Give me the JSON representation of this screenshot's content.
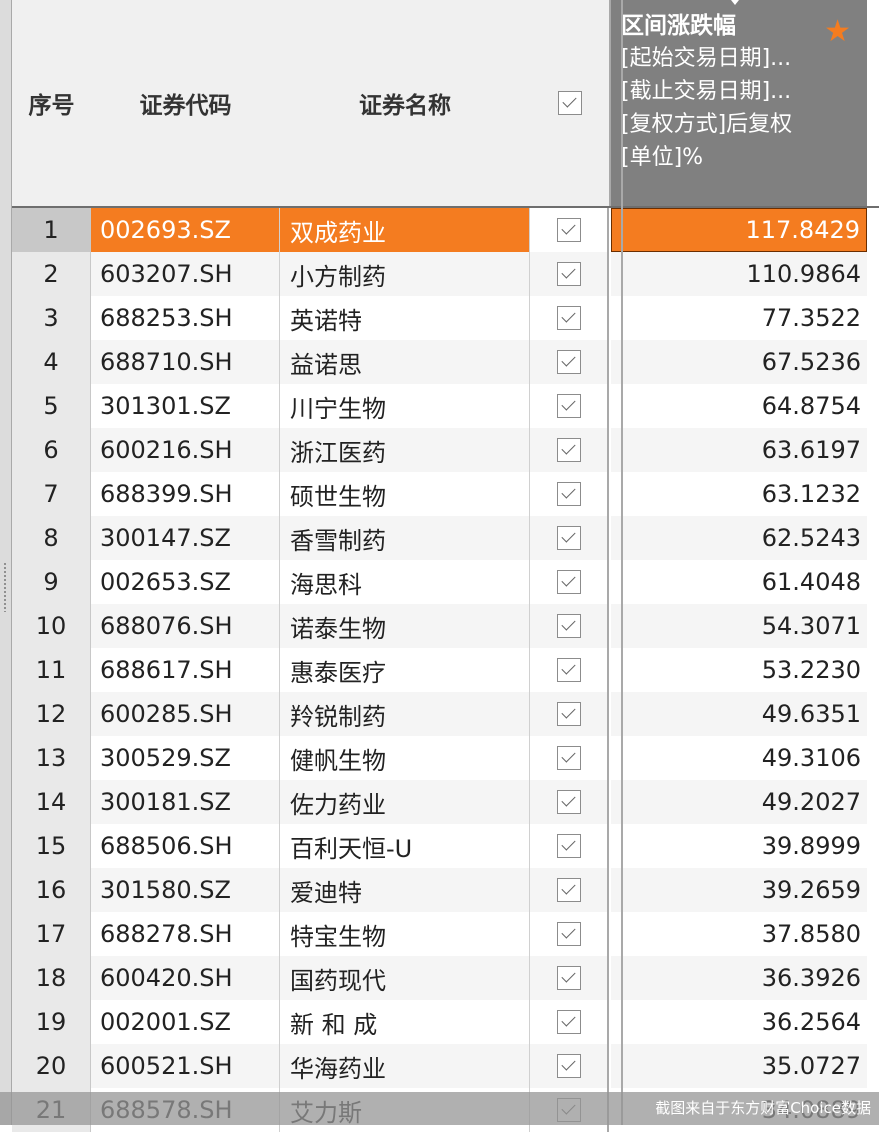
{
  "header": {
    "col_no": "序号",
    "col_code": "证券代码",
    "col_name": "证券名称",
    "col_change": {
      "title": "区间涨跌幅",
      "lines": [
        "[起始交易日期]...",
        "[截止交易日期]...",
        "[复权方式]后复权",
        "[单位]%"
      ],
      "star_icon": "star-icon"
    }
  },
  "rows": [
    {
      "no": "1",
      "code": "002693.SZ",
      "name": "双成药业",
      "value": "117.8429",
      "checked": true
    },
    {
      "no": "2",
      "code": "603207.SH",
      "name": "小方制药",
      "value": "110.9864",
      "checked": true
    },
    {
      "no": "3",
      "code": "688253.SH",
      "name": "英诺特",
      "value": "77.3522",
      "checked": true
    },
    {
      "no": "4",
      "code": "688710.SH",
      "name": "益诺思",
      "value": "67.5236",
      "checked": true
    },
    {
      "no": "5",
      "code": "301301.SZ",
      "name": "川宁生物",
      "value": "64.8754",
      "checked": true
    },
    {
      "no": "6",
      "code": "600216.SH",
      "name": "浙江医药",
      "value": "63.6197",
      "checked": true
    },
    {
      "no": "7",
      "code": "688399.SH",
      "name": "硕世生物",
      "value": "63.1232",
      "checked": true
    },
    {
      "no": "8",
      "code": "300147.SZ",
      "name": "香雪制药",
      "value": "62.5243",
      "checked": true
    },
    {
      "no": "9",
      "code": "002653.SZ",
      "name": "海思科",
      "value": "61.4048",
      "checked": true
    },
    {
      "no": "10",
      "code": "688076.SH",
      "name": "诺泰生物",
      "value": "54.3071",
      "checked": true
    },
    {
      "no": "11",
      "code": "688617.SH",
      "name": "惠泰医疗",
      "value": "53.2230",
      "checked": true
    },
    {
      "no": "12",
      "code": "600285.SH",
      "name": "羚锐制药",
      "value": "49.6351",
      "checked": true
    },
    {
      "no": "13",
      "code": "300529.SZ",
      "name": "健帆生物",
      "value": "49.3106",
      "checked": true
    },
    {
      "no": "14",
      "code": "300181.SZ",
      "name": "佐力药业",
      "value": "49.2027",
      "checked": true
    },
    {
      "no": "15",
      "code": "688506.SH",
      "name": "百利天恒-U",
      "value": "39.8999",
      "checked": true
    },
    {
      "no": "16",
      "code": "301580.SZ",
      "name": "爱迪特",
      "value": "39.2659",
      "checked": true
    },
    {
      "no": "17",
      "code": "688278.SH",
      "name": "特宝生物",
      "value": "37.8580",
      "checked": true
    },
    {
      "no": "18",
      "code": "600420.SH",
      "name": "国药现代",
      "value": "36.3926",
      "checked": true
    },
    {
      "no": "19",
      "code": "002001.SZ",
      "name": "新 和 成",
      "value": "36.2564",
      "checked": true
    },
    {
      "no": "20",
      "code": "600521.SH",
      "name": "华海药业",
      "value": "35.0727",
      "checked": true
    },
    {
      "no": "21",
      "code": "688578.SH",
      "name": "艾力斯",
      "value": "34.0889",
      "checked": true
    }
  ],
  "selected_row": "1",
  "colors": {
    "accent": "#f47c20",
    "header_dark": "#808080"
  },
  "watermark": "截图来自于东方财富Choice数据"
}
